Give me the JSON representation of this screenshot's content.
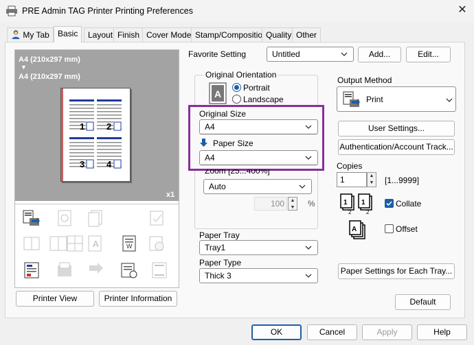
{
  "window": {
    "title": "PRE Admin TAG Printer Printing Preferences"
  },
  "tabs": [
    {
      "label": "My Tab"
    },
    {
      "label": "Basic"
    },
    {
      "label": "Layout"
    },
    {
      "label": "Finish"
    },
    {
      "label": "Cover Mode"
    },
    {
      "label": "Stamp/Composition"
    },
    {
      "label": "Quality"
    },
    {
      "label": "Other"
    }
  ],
  "preview": {
    "original_size_text": "A4 (210x297 mm)",
    "arrow": "▼",
    "paper_size_text": "A4 (210x297 mm)",
    "copies_badge": "x1",
    "page_numbers": [
      "1",
      "2",
      "3",
      "4"
    ]
  },
  "favorite": {
    "label": "Favorite Setting",
    "value": "Untitled",
    "add_label": "Add...",
    "edit_label": "Edit..."
  },
  "orientation": {
    "group_label": "Original Orientation",
    "portrait_label": "Portrait",
    "landscape_label": "Landscape",
    "selected": "Portrait"
  },
  "original_size": {
    "label": "Original Size",
    "value": "A4"
  },
  "paper_size": {
    "label": "Paper Size",
    "value": "A4"
  },
  "zoom": {
    "label": "Zoom [25...400%]",
    "value": "Auto",
    "percent_value": "100",
    "unit": "%"
  },
  "paper_tray": {
    "label": "Paper Tray",
    "value": "Tray1"
  },
  "paper_type": {
    "label": "Paper Type",
    "value": "Thick 3"
  },
  "output_method": {
    "label": "Output Method",
    "value": "Print"
  },
  "buttons": {
    "user_settings": "User Settings...",
    "authentication": "Authentication/Account Track...",
    "paper_settings": "Paper Settings for Each Tray...",
    "default": "Default",
    "printer_view": "Printer View",
    "printer_information": "Printer Information",
    "ok": "OK",
    "cancel": "Cancel",
    "apply": "Apply",
    "help": "Help"
  },
  "copies": {
    "label": "Copies",
    "value": "1",
    "range": "[1...9999]",
    "collate_label": "Collate",
    "collate_checked": true,
    "offset_label": "Offset",
    "offset_checked": false
  },
  "colors": {
    "accent": "#1b5ea8",
    "highlight": "#8a2c9c",
    "preview_bg": "#a3a3a3"
  }
}
